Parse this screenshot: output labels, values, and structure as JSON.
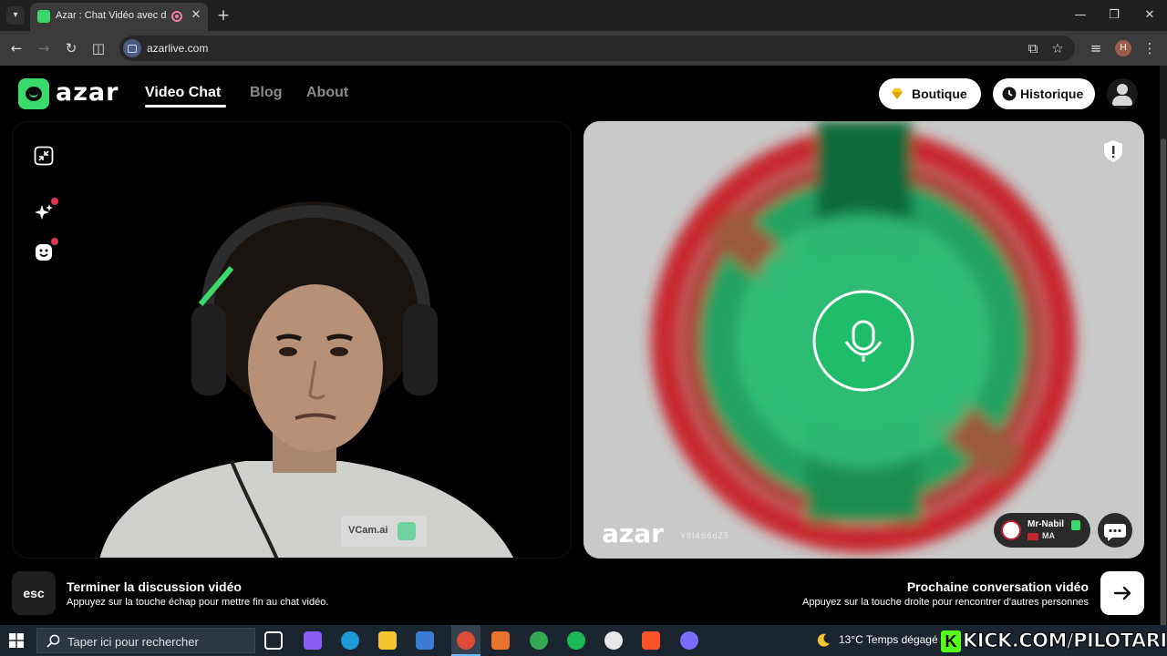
{
  "browser": {
    "tab_title": "Azar : Chat Vidéo avec de n",
    "new_tab_symbol": "+",
    "url": "azarlive.com",
    "profile_initial": "H"
  },
  "site": {
    "logo_text": "azar",
    "nav": [
      "Video Chat",
      "Blog",
      "About"
    ],
    "boutique_label": "Boutique",
    "historique_label": "Historique"
  },
  "remote": {
    "watermark": "azar",
    "watermark_code": "Y9I4S6dZ5",
    "user_name": "Mr-Nabil",
    "country": "MA"
  },
  "local": {
    "vcam_label": "VCam.ai"
  },
  "footer": {
    "esc_key": "esc",
    "end_title": "Terminer la discussion vidéo",
    "end_sub": "Appuyez sur la touche échap pour mettre fin au chat vidéo.",
    "next_title": "Prochaine conversation vidéo",
    "next_sub": "Appuyez sur la touche droite pour rencontrer d'autres personnes"
  },
  "taskbar": {
    "search_placeholder": "Taper ici pour rechercher",
    "weather": "13°C  Temps dégagé",
    "overlay": "KICK.COM/PILOTARIFI",
    "overlay_k": "K"
  },
  "colors": {
    "brand_green": "#3bd86c",
    "accent_red": "#e2344f"
  }
}
